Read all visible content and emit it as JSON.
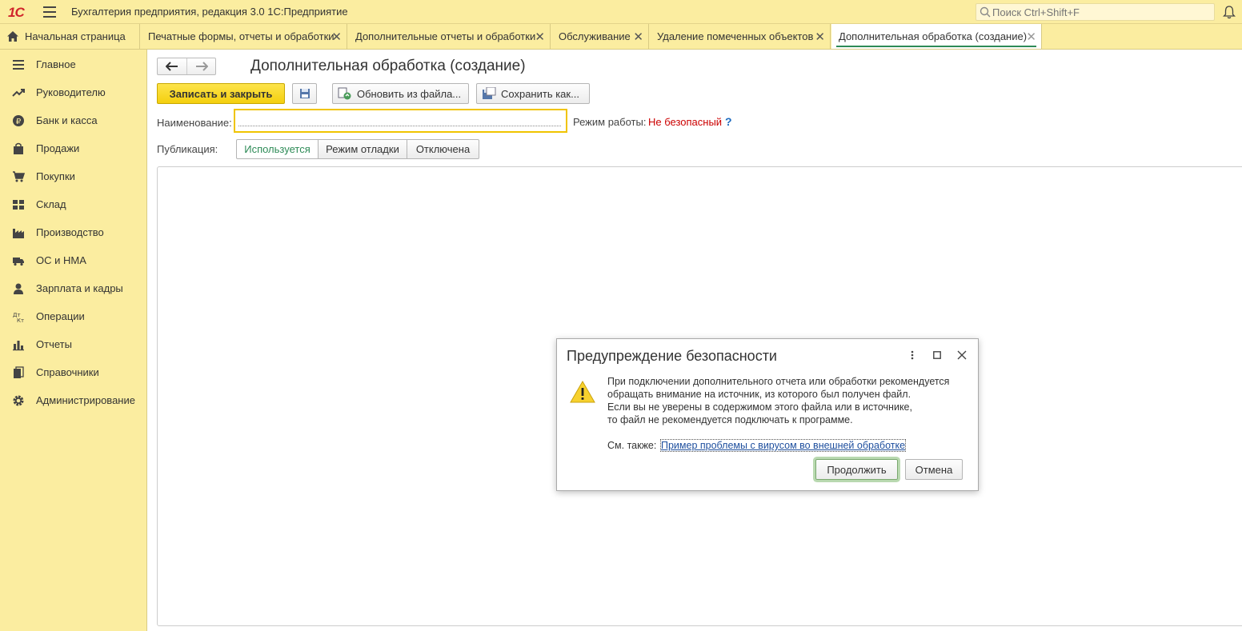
{
  "app": {
    "logo": "1С",
    "title": "Бухгалтерия предприятия, редакция 3.0 1С:Предприятие",
    "search_placeholder": "Поиск Ctrl+Shift+F"
  },
  "tabs": [
    {
      "label": "Начальная страница",
      "icon": "home-icon"
    },
    {
      "label": "Печатные формы, отчеты и обработки"
    },
    {
      "label": "Дополнительные отчеты и обработки"
    },
    {
      "label": "Обслуживание"
    },
    {
      "label": "Удаление помеченных объектов"
    },
    {
      "label": "Дополнительная обработка (создание)",
      "active": true
    }
  ],
  "sidebar": {
    "items": [
      {
        "label": "Главное",
        "icon": "list-icon"
      },
      {
        "label": "Руководителю",
        "icon": "trend-icon"
      },
      {
        "label": "Банк и касса",
        "icon": "ruble-icon"
      },
      {
        "label": "Продажи",
        "icon": "bag-icon"
      },
      {
        "label": "Покупки",
        "icon": "cart-icon"
      },
      {
        "label": "Склад",
        "icon": "warehouse-icon"
      },
      {
        "label": "Производство",
        "icon": "factory-icon"
      },
      {
        "label": "ОС и НМА",
        "icon": "truck-icon"
      },
      {
        "label": "Зарплата и кадры",
        "icon": "person-icon"
      },
      {
        "label": "Операции",
        "icon": "dt-kt-icon"
      },
      {
        "label": "Отчеты",
        "icon": "bar-chart-icon"
      },
      {
        "label": "Справочники",
        "icon": "books-icon"
      },
      {
        "label": "Администрирование",
        "icon": "gear-icon"
      }
    ]
  },
  "form": {
    "title": "Дополнительная обработка (создание)",
    "save_close": "Записать и закрыть",
    "update_from_file": "Обновить из файла...",
    "save_as": "Сохранить как...",
    "name_label": "Наименование:",
    "name_value": "",
    "mode_label": "Режим работы:",
    "mode_value": "Не безопасный",
    "help": "?",
    "publication_label": "Публикация:",
    "publication_options": [
      "Используется",
      "Режим отладки",
      "Отключена"
    ],
    "publication_selected": "Используется"
  },
  "dialog": {
    "title": "Предупреждение безопасности",
    "lines": [
      "При подключении дополнительного отчета или обработки рекомендуется",
      "обращать внимание на источник, из которого был получен файл.",
      "Если вы не уверены в содержимом этого файла или в источнике,",
      "то файл не рекомендуется подключать к программе."
    ],
    "see_also": "См. также:",
    "link": "Пример проблемы с вирусом во внешней обработке",
    "continue": "Продолжить",
    "cancel": "Отмена"
  },
  "colors": {
    "bar_bg": "#fbeda0",
    "primary_button": "#f4cf0e",
    "accent_green": "#2e8b57",
    "warning_red": "#cc0000",
    "link_blue": "#1e4f9e"
  }
}
